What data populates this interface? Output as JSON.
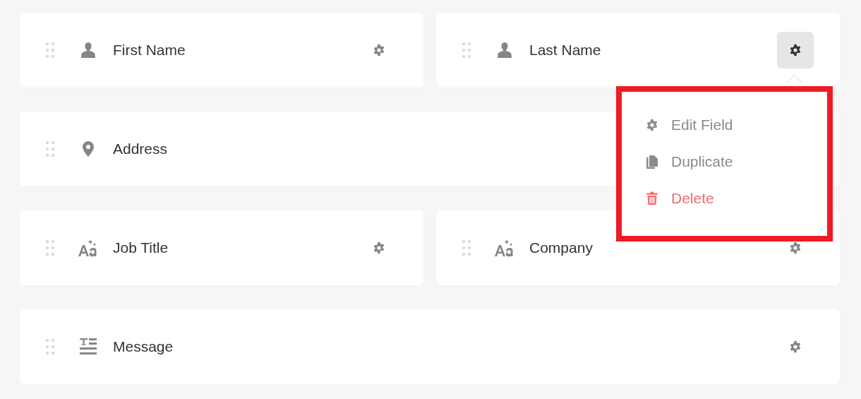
{
  "fields": [
    {
      "label": "First Name",
      "kind": "person",
      "wide": false,
      "menu_open": false
    },
    {
      "label": "Last Name",
      "kind": "person",
      "wide": false,
      "menu_open": true
    },
    {
      "label": "Address",
      "kind": "pin",
      "wide": true
    },
    {
      "label": "Job Title",
      "kind": "text",
      "wide": false,
      "menu_open": false
    },
    {
      "label": "Company",
      "kind": "text",
      "wide": false,
      "menu_open": false
    },
    {
      "label": "Message",
      "kind": "paragraph",
      "wide": true,
      "menu_open": false
    }
  ],
  "menu": {
    "items": [
      {
        "label": "Edit Field",
        "kind": "edit",
        "danger": false
      },
      {
        "label": "Duplicate",
        "kind": "duplicate",
        "danger": false
      },
      {
        "label": "Delete",
        "kind": "delete",
        "danger": true
      }
    ]
  }
}
